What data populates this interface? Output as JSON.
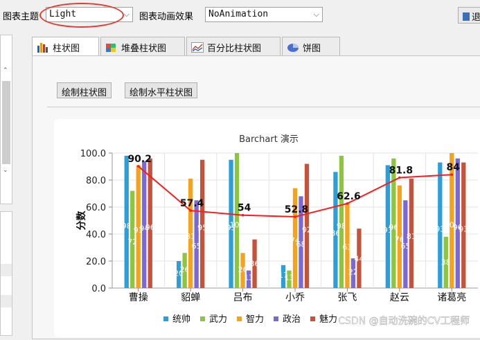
{
  "toolbar": {
    "theme_label": "图表主题",
    "theme_value": "Light",
    "animation_label": "图表动画效果",
    "animation_value": "NoAnimation",
    "right_button_label": "退"
  },
  "tabs": [
    {
      "label": "柱状图",
      "active": true,
      "icon": "bar-chart-icon"
    },
    {
      "label": "堆叠柱状图",
      "active": false,
      "icon": "stacked-chart-icon"
    },
    {
      "label": "百分比柱状图",
      "active": false,
      "icon": "percent-chart-icon"
    },
    {
      "label": "饼图",
      "active": false,
      "icon": "pie-chart-icon"
    }
  ],
  "buttons": {
    "draw_bar": "绘制柱状图",
    "draw_hbar": "绘制水平柱状图"
  },
  "watermark": "CSDN @自动洗碗的CV工程师",
  "colors": {
    "统帅": "#2c9fd9",
    "武力": "#8cc63f",
    "智力": "#f7a21b",
    "政治": "#7b68d6",
    "魅力": "#c6523b",
    "line": "#ff1a1a"
  },
  "chart_data": {
    "type": "bar",
    "title": "Barchart 演示",
    "ylabel": "分数",
    "xlabel": "",
    "ylim": [
      0,
      100
    ],
    "yticks": [
      "0.0",
      "20.0",
      "40.0",
      "60.0",
      "80.0",
      "100.0"
    ],
    "categories": [
      "曹操",
      "貂蝉",
      "吕布",
      "小乔",
      "张飞",
      "赵云",
      "诸葛亮"
    ],
    "series": [
      {
        "name": "统帅",
        "values": [
          98,
          20,
          95,
          17,
          86,
          91,
          93
        ]
      },
      {
        "name": "武力",
        "values": [
          72,
          26,
          100,
          13,
          98,
          96,
          38
        ]
      },
      {
        "name": "智力",
        "values": [
          91,
          81,
          26,
          74,
          63,
          76,
          100
        ]
      },
      {
        "name": "政治",
        "values": [
          94,
          65,
          13,
          68,
          22,
          65,
          96
        ]
      },
      {
        "name": "魅力",
        "values": [
          96,
          95,
          36,
          92,
          44,
          81,
          93
        ]
      }
    ],
    "average_line": {
      "values": [
        90.2,
        57.4,
        54,
        52.8,
        62.6,
        81.8,
        84
      ],
      "labels": [
        "90.2",
        "57.4",
        "54",
        "52.8",
        "62.6",
        "81.8",
        "84"
      ]
    },
    "legend": [
      "统帅",
      "武力",
      "智力",
      "政治",
      "魅力"
    ],
    "legend_position": "bottom"
  }
}
